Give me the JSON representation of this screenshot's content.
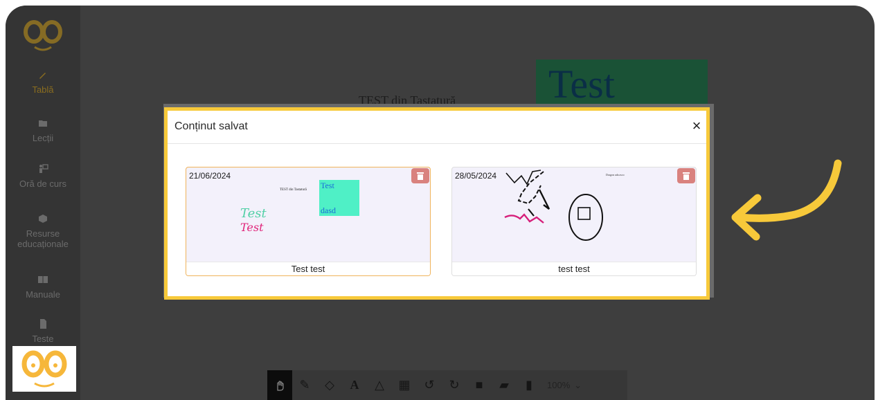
{
  "sidebar": {
    "items": [
      {
        "label": "Tablă",
        "icon": "pencil-icon",
        "active": true
      },
      {
        "label": "Lecții",
        "icon": "folder-icon",
        "active": false
      },
      {
        "label": "Oră de curs",
        "icon": "teacher-icon",
        "active": false
      },
      {
        "label": "Resurse educaționale",
        "icon": "cube-icon",
        "active": false
      },
      {
        "label": "Manuale",
        "icon": "book-icon",
        "active": false
      },
      {
        "label": "Teste",
        "icon": "file-icon",
        "active": false
      }
    ]
  },
  "canvas": {
    "heading": "TEST din Tastatură",
    "box_text": "Test"
  },
  "toolbar": {
    "tools": [
      "hand-icon",
      "pen-icon",
      "eraser-icon",
      "text-icon",
      "shapes-icon",
      "grid-icon",
      "undo-icon",
      "redo-icon",
      "save-icon",
      "open-folder-icon",
      "trash-icon"
    ],
    "zoom": "100%"
  },
  "modal": {
    "title": "Conținut salvat",
    "close_label": "×",
    "cards": [
      {
        "date": "21/06/2024",
        "name": "Test test",
        "preview_heading": "TEST din Tastatură",
        "preview_box_line1": "Test",
        "preview_box_line2": "dasd",
        "preview_hand1": "Test",
        "preview_hand2": "Test"
      },
      {
        "date": "28/05/2024",
        "name": "test test",
        "preview_heading": "Dragon ada asco"
      }
    ]
  },
  "colors": {
    "highlight": "#f7c93a",
    "delete_button": "#d9827e",
    "preview_box": "#4ff0c6"
  }
}
